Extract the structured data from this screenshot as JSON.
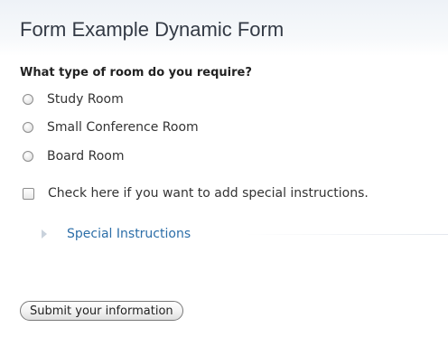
{
  "header": {
    "title": "Form Example Dynamic Form"
  },
  "form": {
    "question": "What type of room do you require?",
    "room_options": [
      {
        "label": "Study Room",
        "selected": false
      },
      {
        "label": "Small Conference Room",
        "selected": false
      },
      {
        "label": "Board Room",
        "selected": false
      }
    ],
    "special_instructions_checkbox": {
      "label": "Check here if you want to add special instructions.",
      "checked": false
    },
    "special_instructions_section": {
      "label": "Special Instructions",
      "expanded": false
    },
    "submit_label": "Submit your information"
  },
  "colors": {
    "link": "#2c6ea8",
    "title": "#333a45"
  },
  "icons": {
    "expand": "triangle-right-icon"
  }
}
